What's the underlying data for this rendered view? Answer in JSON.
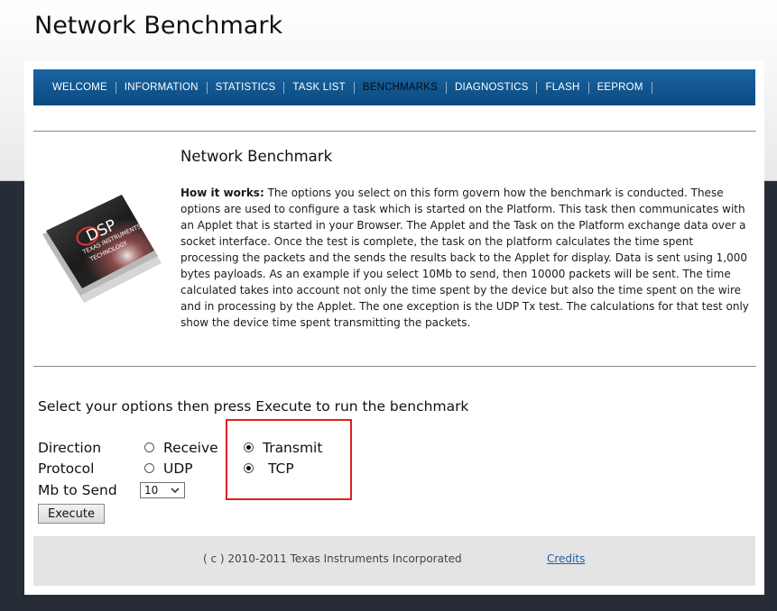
{
  "header": {
    "title": "Network Benchmark"
  },
  "nav": {
    "items": [
      {
        "label": "WELCOME"
      },
      {
        "label": "INFORMATION"
      },
      {
        "label": "STATISTICS"
      },
      {
        "label": "TASK LIST"
      },
      {
        "label": "BENCHMARKS",
        "active": true
      },
      {
        "label": "DIAGNOSTICS"
      },
      {
        "label": "FLASH"
      },
      {
        "label": "EEPROM"
      }
    ]
  },
  "chip": {
    "icon": "dsp-chip-image",
    "text_lines": [
      "DSP",
      "TEXAS INSTRUMENTS",
      "TECHNOLOGY"
    ]
  },
  "main": {
    "heading": "Network Benchmark",
    "how_label": "How it works:",
    "description": " The options you select on this form govern how the benchmark is conducted. These options are used to configure a task which is started on the Platform. This task then communicates with an Applet that is started in your Browser. The Applet and the Task on the Platform exchange data over a socket interface. Once the test is complete, the task on the platform calculates the time spent processing the packets and the sends the results back to the Applet for display.  Data is sent using 1,000 bytes payloads.  As an example if you select 10Mb to send, then 10000 packets will be sent. The time calculated takes into account not only the time spent by the device but also the time spent on the wire and in processing by the Applet. The one exception is the UDP Tx test. The calculations for that test only show the device time spent transmitting the packets."
  },
  "form": {
    "instructions": "Select your options then press Execute to run the benchmark",
    "direction": {
      "label": "Direction",
      "options": [
        {
          "label": "Receive",
          "checked": false
        },
        {
          "label": "Transmit",
          "checked": true
        }
      ]
    },
    "protocol": {
      "label": "Protocol",
      "options": [
        {
          "label": "UDP",
          "checked": false
        },
        {
          "label": "TCP",
          "checked": true
        }
      ]
    },
    "mb_to_send": {
      "label": "Mb to Send",
      "value": "10"
    },
    "execute_label": "Execute"
  },
  "footer": {
    "copyright": "( c ) 2010-2011 Texas Instruments Incorporated",
    "credits_label": "Credits"
  },
  "colors": {
    "nav_bar": "#0f5791",
    "highlight_box": "#e02020",
    "page_background": "#262d36",
    "link": "#1b5fa8"
  }
}
